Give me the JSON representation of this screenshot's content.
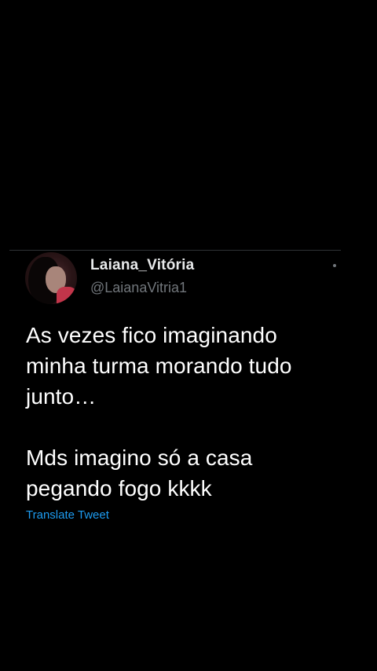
{
  "tweet": {
    "display_name": "Laiana_Vitória",
    "handle": "@LaianaVitria1",
    "text": "As vezes fico imaginando\nminha turma morando tudo\njunto…\n\nMds imagino só a casa\npegando fogo kkkk",
    "translate_label": "Translate Tweet"
  },
  "colors": {
    "background": "#000000",
    "link": "#1d9bf0",
    "secondary_text": "#71767b"
  }
}
